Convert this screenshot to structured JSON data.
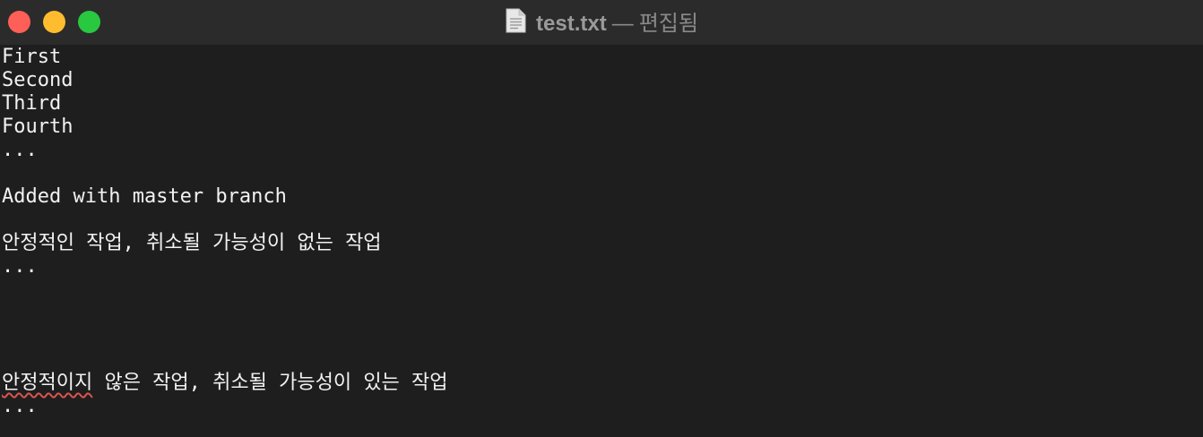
{
  "window": {
    "file_name": "test.txt",
    "separator": "—",
    "status": "편집됨"
  },
  "editor": {
    "lines": [
      "First",
      "Second",
      "Third",
      "Fourth",
      "...",
      "",
      "Added with master branch",
      "",
      "안정적인 작업, 취소될 가능성이 없는 작업",
      "...",
      "",
      "",
      "",
      "",
      "",
      "...",
      ""
    ],
    "line_15_misspelled": "안정적이지",
    "line_15_rest": " 않은 작업, 취소될 가능성이 있는 작업"
  }
}
